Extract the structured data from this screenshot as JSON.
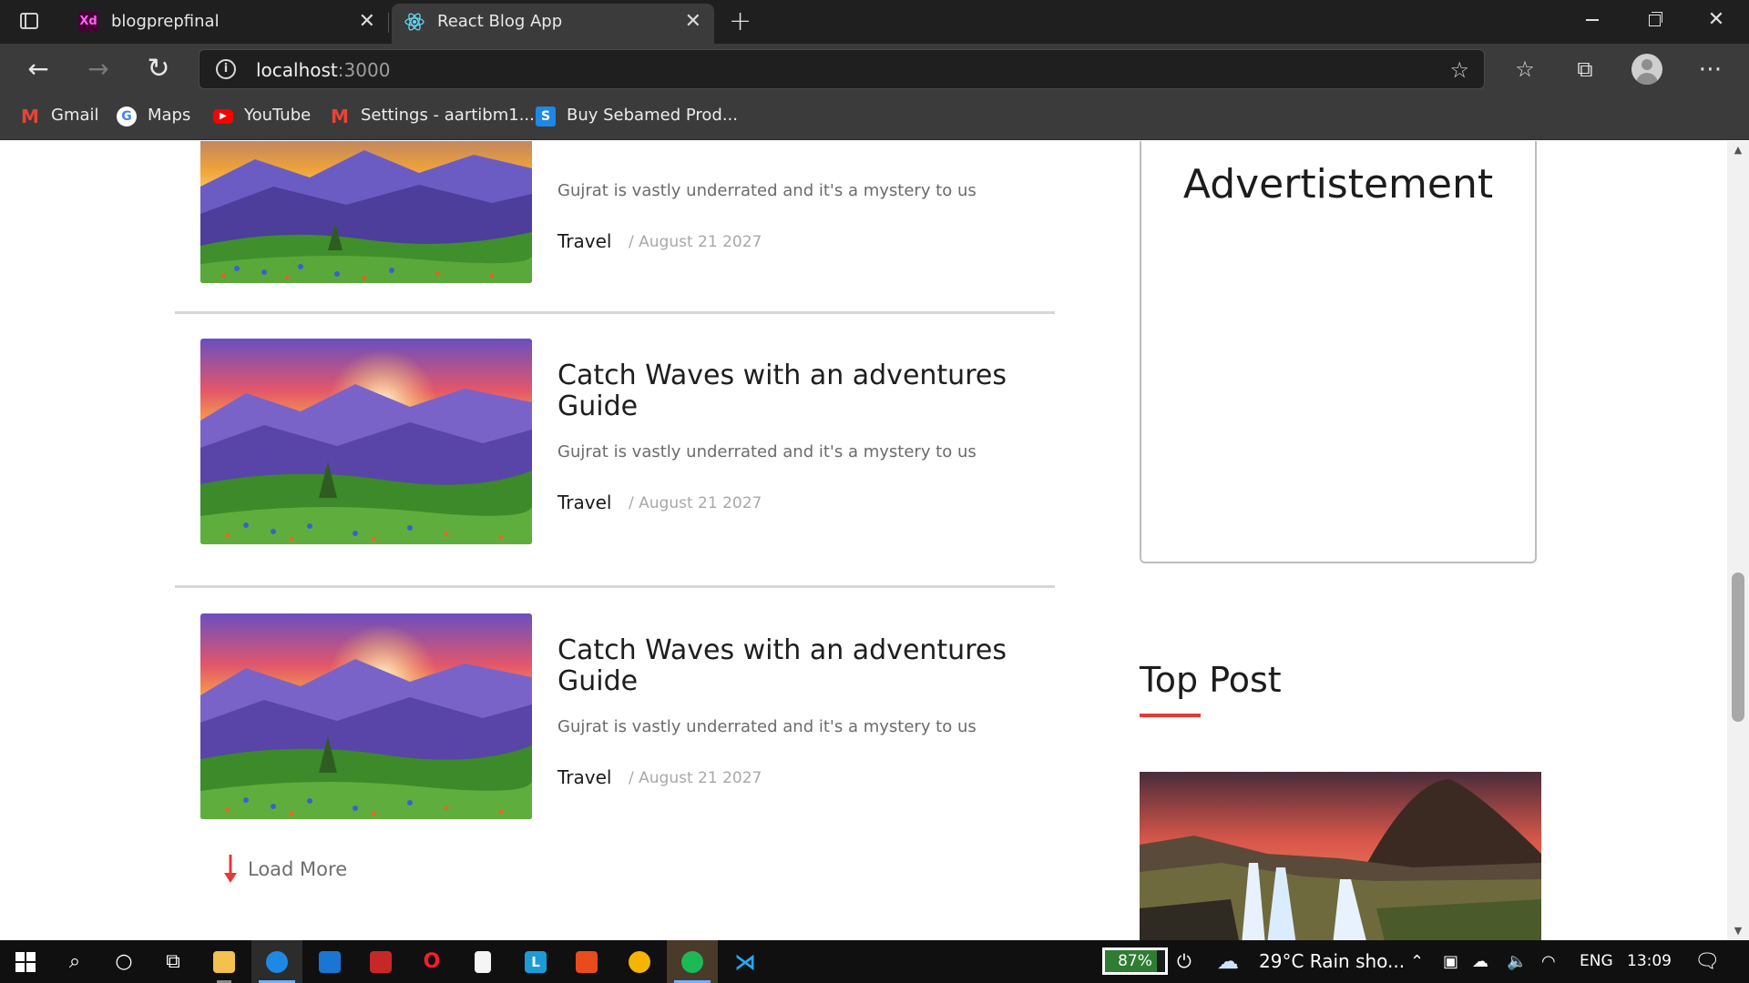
{
  "browser": {
    "tabs": [
      {
        "title": "blogprepfinal",
        "favicon": "Xd"
      },
      {
        "title": "React Blog App",
        "favicon": "react-icon"
      }
    ],
    "address": {
      "host": "localhost",
      "port": ":3000"
    },
    "bookmarks": [
      {
        "label": "Gmail",
        "icon": "M"
      },
      {
        "label": "Maps",
        "icon": "G"
      },
      {
        "label": "YouTube",
        "icon": "▶"
      },
      {
        "label": "Settings - aartibm1...",
        "icon": "M"
      },
      {
        "label": "Buy Sebamed Prod...",
        "icon": "S"
      }
    ]
  },
  "posts": [
    {
      "title": "",
      "excerpt": "Gujrat is vastly underrated and it's a mystery to us",
      "category": "Travel",
      "date": "/ August 21 2027"
    },
    {
      "title": "Catch Waves with an adventures Guide",
      "excerpt": "Gujrat is vastly underrated and it's a mystery to us",
      "category": "Travel",
      "date": "/ August 21 2027"
    },
    {
      "title": "Catch Waves with an adventures Guide",
      "excerpt": "Gujrat is vastly underrated and it's a mystery to us",
      "category": "Travel",
      "date": "/ August 21 2027"
    }
  ],
  "load_more": "Load More",
  "sidebar": {
    "ad_title": "Advertistement",
    "top_post_heading": "Top Post"
  },
  "taskbar": {
    "battery": "87%",
    "battery_level": 0.87,
    "weather": "29°C  Rain sho...",
    "language": "ENG",
    "time": "13:09"
  },
  "colors": {
    "accent_red": "#e53935",
    "battery_green": "#2e7d32"
  }
}
